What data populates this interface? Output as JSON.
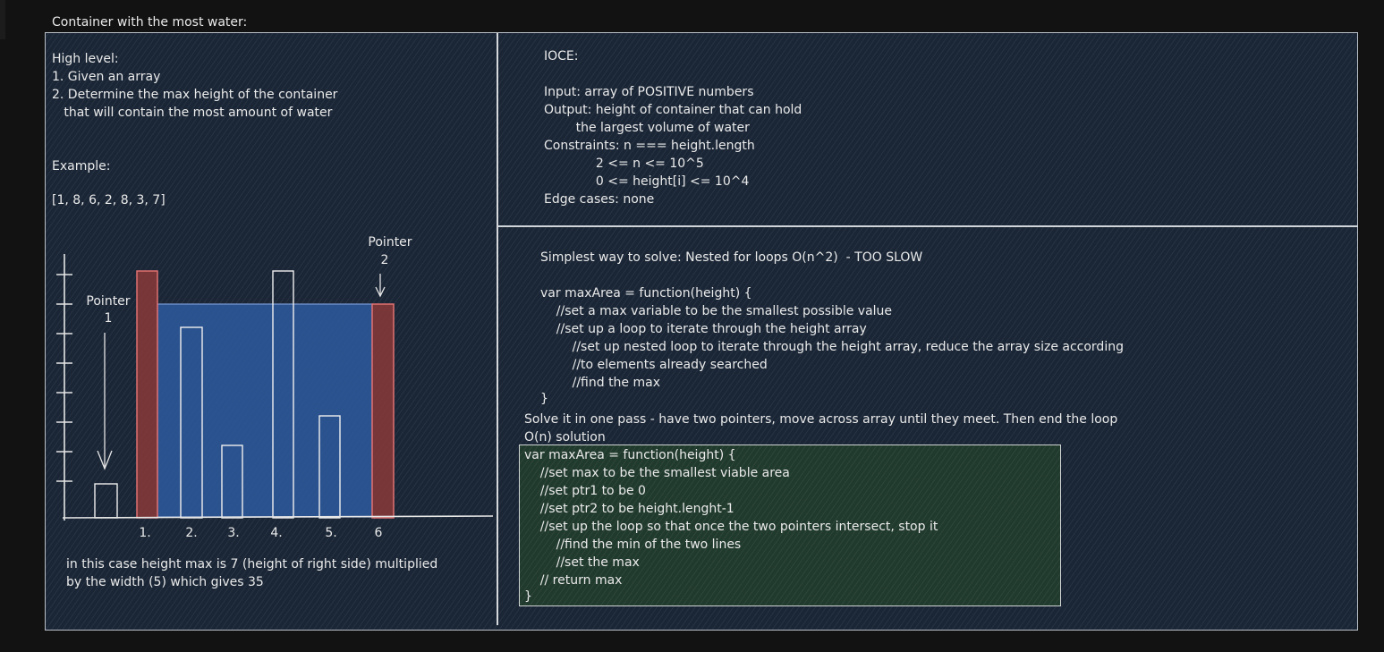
{
  "title": "Container with the most water:",
  "high_level": {
    "heading": "High level:",
    "line1": "1. Given an array",
    "line2": "2. Determine the max height of the container",
    "line3": "   that will contain the most amount of water"
  },
  "example": {
    "heading": "Example:",
    "array": "[1, 8, 6, 2, 8, 3, 7]"
  },
  "diagram": {
    "pointer1": [
      "Pointer",
      "1"
    ],
    "pointer2": [
      "Pointer",
      "2"
    ],
    "x_labels": [
      "1.",
      "2.",
      "3.",
      "4.",
      "5.",
      "6"
    ],
    "conclusion_line1": "in this case height max is 7 (height of right side) multiplied",
    "conclusion_line2": "by the width (5) which gives 35",
    "colors": {
      "pointer_bar": "#e07070",
      "water": "#2e5a9e",
      "bar": "#f0f0f0"
    }
  },
  "ioce": {
    "heading": "IOCE:",
    "input": "Input: array of POSITIVE numbers",
    "output1": "Output: height of container that can hold",
    "output2": "        the largest volume of water",
    "constraints1": "Constraints: n === height.length",
    "constraints2": "             2 <= n <= 10^5",
    "constraints3": "             0 <= height[i] <= 10^4",
    "edge": "Edge cases: none"
  },
  "solution": {
    "simplest": "Simplest way to solve: Nested for loops O(n^2)  - TOO SLOW",
    "nested_code": [
      "var maxArea = function(height) {",
      "    //set a max variable to be the smallest possible value",
      "    //set up a loop to iterate through the height array",
      "        //set up nested loop to iterate through the height array, reduce the array size according",
      "        //to elements already searched",
      "        //find the max",
      "}"
    ],
    "one_pass": "Solve it in one pass - have two pointers, move across array until they meet. Then end the loop",
    "on_solution": "O(n) solution",
    "optimal_code": [
      "var maxArea = function(height) {",
      "    //set max to be the smallest viable area",
      "    //set ptr1 to be 0",
      "    //set ptr2 to be height.lenght-1",
      "    //set up the loop so that once the two pointers intersect, stop it",
      "        //find the min of the two lines",
      "        //set the max",
      "    // return max",
      "}"
    ]
  }
}
